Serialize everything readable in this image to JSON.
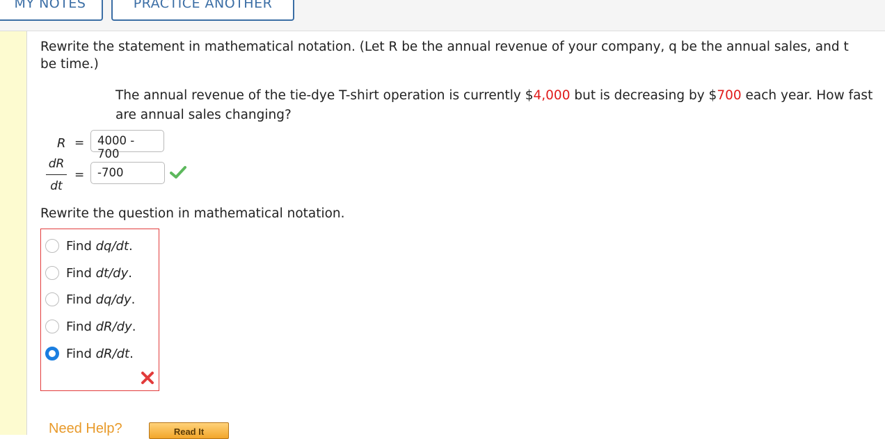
{
  "toolbar": {
    "my_notes_label": "MY NOTES",
    "practice_label": "PRACTICE ANOTHER"
  },
  "problem": {
    "prompt": "Rewrite the statement in mathematical notation. (Let R be the annual revenue of your company, q be the annual sales, and t be time.)",
    "statement_parts": {
      "p1": "The annual revenue of the tie-dye T-shirt operation is currently $",
      "v1": "4,000",
      "p2": " but is decreasing by $",
      "v2": "700",
      "p3": " each year. How fast are annual sales changing?"
    },
    "eq1": {
      "label": "R",
      "sign": "=",
      "value": "4000 - 700"
    },
    "eq2": {
      "numerator": "dR",
      "denominator": "dt",
      "sign": "=",
      "value": "-700",
      "status": "correct"
    },
    "question": "Rewrite the question in mathematical notation.",
    "choices": [
      {
        "prefix": "Find ",
        "expr": "dq/dt",
        "suffix": ".",
        "selected": false
      },
      {
        "prefix": "Find ",
        "expr": "dt/dy",
        "suffix": ".",
        "selected": false
      },
      {
        "prefix": "Find ",
        "expr": "dq/dy",
        "suffix": ".",
        "selected": false
      },
      {
        "prefix": "Find ",
        "expr": "dR/dy",
        "suffix": ".",
        "selected": false
      },
      {
        "prefix": "Find ",
        "expr": "dR/dt",
        "suffix": ".",
        "selected": true
      }
    ],
    "choices_status": "incorrect"
  },
  "help": {
    "label": "Need Help?",
    "read_it_label": "Read It"
  },
  "colors": {
    "accent_red": "#e01b1b",
    "check_green": "#5cb85c",
    "selected_blue": "#1a7ee0"
  }
}
